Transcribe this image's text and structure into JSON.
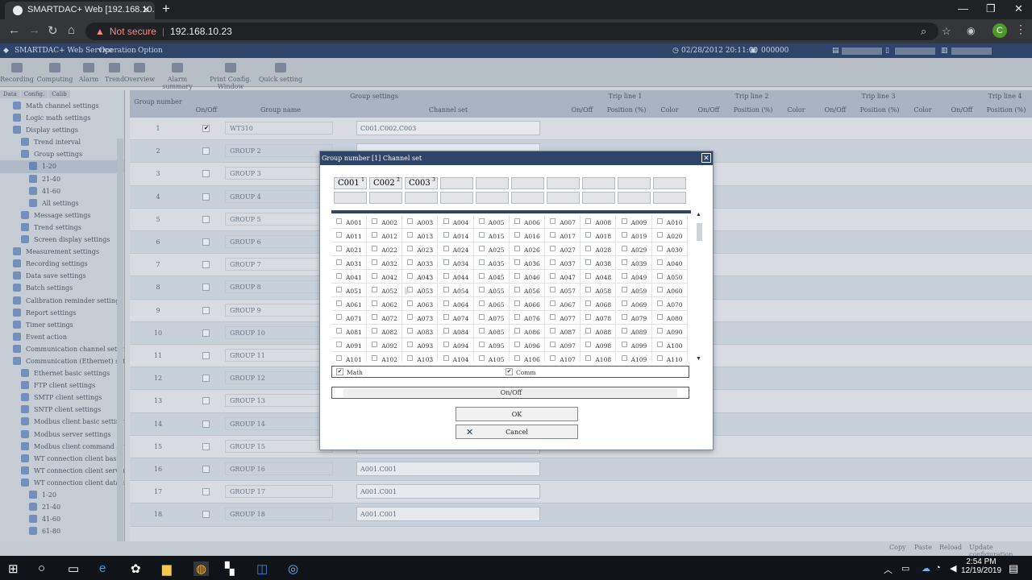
{
  "browser": {
    "tab_title": "SMARTDAC+ Web [192.168.10.2",
    "url": "192.168.10.23",
    "not_secure": "Not secure",
    "profile_initial": "C"
  },
  "app": {
    "title": "SMARTDAC+ Web Service",
    "menu": [
      "Operation",
      "Option"
    ],
    "datetime": "02/28/2012 20:11:00",
    "counter": "000000",
    "tools": [
      "Recording",
      "Computing",
      "Alarm",
      "Trend",
      "Overview",
      "Alarm summary",
      "Print Config. Window",
      "Quick setting"
    ],
    "side_tabs": [
      "Data",
      "Config.",
      "Calib"
    ],
    "tree": [
      "Math channel settings",
      "Logic math settings",
      "Display settings",
      "Trend interval",
      "Group settings",
      "1-20",
      "21-40",
      "41-60",
      "All settings",
      "Message settings",
      "Trend settings",
      "Screen display settings",
      "Measurement settings",
      "Recording settings",
      "Data save settings",
      "Batch settings",
      "Calibration reminder settings",
      "Report settings",
      "Timer settings",
      "Event action",
      "Communication channel settings",
      "Communication (Ethernet) settings",
      "Ethernet basic settings",
      "FTP client settings",
      "SMTP client settings",
      "SNTP client settings",
      "Modbus client basic settings",
      "Modbus server settings",
      "Modbus client command settings",
      "WT connection client basic settin",
      "WT connection client server setti",
      "WT connection client data alloca",
      "1-20",
      "21-40",
      "41-60",
      "61-80"
    ],
    "table": {
      "col_group_number": "Group number",
      "col_group_settings": "Group settings",
      "col_onoff": "On/Off",
      "col_group_name": "Group name",
      "col_channel_set": "Channel set",
      "trip_lines": [
        "Trip line 1",
        "Trip line 2",
        "Trip line 3",
        "Trip line 4"
      ],
      "trip_cols": [
        "On/Off",
        "Position (%)",
        "Color"
      ],
      "rows": [
        {
          "n": "1",
          "name": "WT310",
          "ch": "C001.C002.C003"
        },
        {
          "n": "2",
          "name": "GROUP 2",
          "ch": ""
        },
        {
          "n": "3",
          "name": "GROUP 3",
          "ch": ""
        },
        {
          "n": "4",
          "name": "GROUP 4",
          "ch": ""
        },
        {
          "n": "5",
          "name": "GROUP 5",
          "ch": ""
        },
        {
          "n": "6",
          "name": "GROUP 6",
          "ch": ""
        },
        {
          "n": "7",
          "name": "GROUP 7",
          "ch": ""
        },
        {
          "n": "8",
          "name": "GROUP 8",
          "ch": ""
        },
        {
          "n": "9",
          "name": "GROUP 9",
          "ch": ""
        },
        {
          "n": "10",
          "name": "GROUP 10",
          "ch": ""
        },
        {
          "n": "11",
          "name": "GROUP 11",
          "ch": ""
        },
        {
          "n": "12",
          "name": "GROUP 12",
          "ch": ""
        },
        {
          "n": "13",
          "name": "GROUP 13",
          "ch": ""
        },
        {
          "n": "14",
          "name": "GROUP 14",
          "ch": ""
        },
        {
          "n": "15",
          "name": "GROUP 15",
          "ch": ""
        },
        {
          "n": "16",
          "name": "GROUP 16",
          "ch": "A001.C001"
        },
        {
          "n": "17",
          "name": "GROUP 17",
          "ch": "A001.C001"
        },
        {
          "n": "18",
          "name": "GROUP 18",
          "ch": "A001.C001"
        }
      ]
    },
    "status_buttons": [
      "Copy",
      "Paste",
      "Reload",
      "Update configuration"
    ]
  },
  "dialog": {
    "title": "Group number [1] Channel set",
    "selected": [
      {
        "ch": "C001",
        "n": "1"
      },
      {
        "ch": "C002",
        "n": "2"
      },
      {
        "ch": "C003",
        "n": "3"
      }
    ],
    "channels": [
      "A001",
      "A002",
      "A003",
      "A004",
      "A005",
      "A006",
      "A007",
      "A008",
      "A009",
      "A010",
      "A011",
      "A012",
      "A013",
      "A014",
      "A015",
      "A016",
      "A017",
      "A018",
      "A019",
      "A020",
      "A021",
      "A022",
      "A023",
      "A024",
      "A025",
      "A026",
      "A027",
      "A028",
      "A029",
      "A030",
      "A031",
      "A032",
      "A033",
      "A034",
      "A035",
      "A036",
      "A037",
      "A038",
      "A039",
      "A040",
      "A041",
      "A042",
      "A043",
      "A044",
      "A045",
      "A046",
      "A047",
      "A048",
      "A049",
      "A050",
      "A051",
      "A052",
      "A053",
      "A054",
      "A055",
      "A056",
      "A057",
      "A058",
      "A059",
      "A060",
      "A061",
      "A062",
      "A063",
      "A064",
      "A065",
      "A066",
      "A067",
      "A068",
      "A069",
      "A070",
      "A071",
      "A072",
      "A073",
      "A074",
      "A075",
      "A076",
      "A077",
      "A078",
      "A079",
      "A080",
      "A081",
      "A082",
      "A083",
      "A084",
      "A085",
      "A086",
      "A087",
      "A088",
      "A089",
      "A090",
      "A091",
      "A092",
      "A093",
      "A094",
      "A095",
      "A096",
      "A097",
      "A098",
      "A099",
      "A100",
      "A101",
      "A102",
      "A103",
      "A104",
      "A105",
      "A106",
      "A107",
      "A108",
      "A109",
      "A110"
    ],
    "math_label": "Math",
    "comm_label": "Comm",
    "onoff_label": "On/Off",
    "ok_label": "OK",
    "cancel_label": "Cancel"
  },
  "taskbar": {
    "time": "2:54 PM",
    "date": "12/19/2019"
  }
}
